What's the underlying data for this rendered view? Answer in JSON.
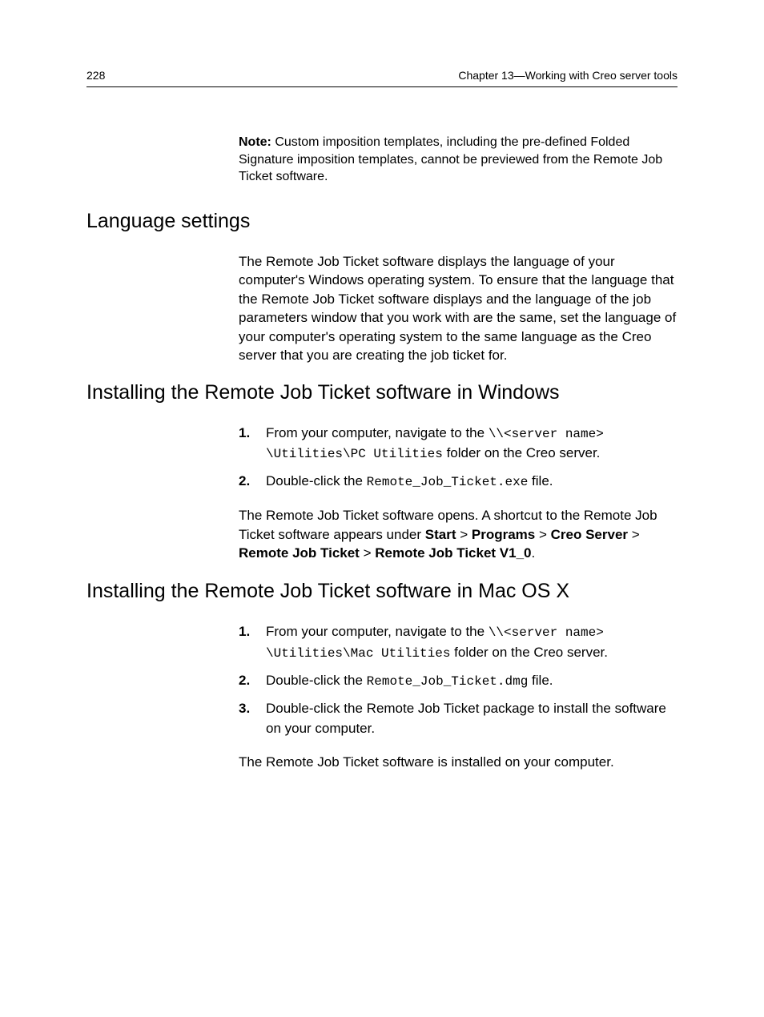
{
  "header": {
    "page_number": "228",
    "chapter": "Chapter 13—Working with Creo server tools"
  },
  "note": {
    "label": "Note:",
    "text": " Custom imposition templates, including the pre-defined Folded Signature imposition templates, cannot be previewed from the Remote Job Ticket software."
  },
  "sections": {
    "lang": {
      "heading": "Language settings",
      "body": "The Remote Job Ticket software displays the language of your computer's Windows operating system. To ensure that the language that the Remote Job Ticket software displays and the language of the job parameters window that you work with are the same, set the language of your computer's operating system to the same language as the Creo server that you are creating the job ticket for."
    },
    "win": {
      "heading": "Installing the Remote Job Ticket software in Windows",
      "step1_a": "From your computer, navigate to the ",
      "step1_code": "\\\\<server name> \\Utilities\\PC Utilities",
      "step1_b": " folder on the Creo server.",
      "step2_a": "Double-click the ",
      "step2_code": "Remote_Job_Ticket.exe",
      "step2_b": " file.",
      "result_a": "The Remote Job Ticket software opens. A shortcut to the Remote Job Ticket software appears under ",
      "r_start": "Start",
      "r_gt1": " > ",
      "r_programs": "Programs",
      "r_gt2": " > ",
      "r_creo": "Creo Server",
      "r_gt3": " > ",
      "r_rjt": "Remote Job Ticket",
      "r_gt4": " > ",
      "r_v1": "Remote Job Ticket V1_0",
      "r_end": "."
    },
    "mac": {
      "heading": "Installing the Remote Job Ticket software in Mac OS X",
      "step1_a": "From your computer, navigate to the ",
      "step1_code": "\\\\<server name> \\Utilities\\Mac Utilities",
      "step1_b": " folder on the Creo server.",
      "step2_a": "Double-click the ",
      "step2_code": "Remote_Job_Ticket.dmg",
      "step2_b": " file.",
      "step3": "Double-click the Remote Job Ticket package to install the software on your computer.",
      "result": "The Remote Job Ticket software is installed on your computer."
    }
  }
}
